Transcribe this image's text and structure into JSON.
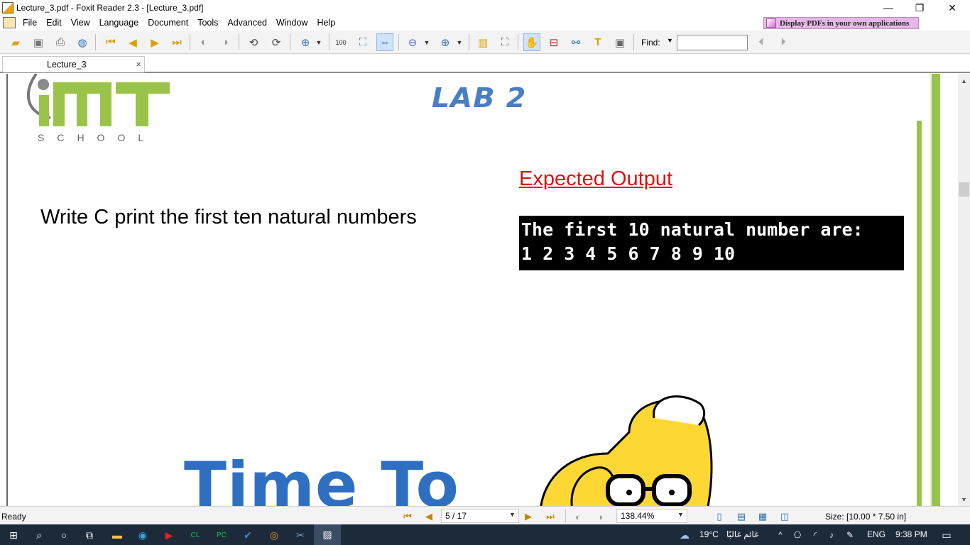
{
  "window": {
    "title": "Lecture_3.pdf - Foxit Reader 2.3 - [Lecture_3.pdf]",
    "minimize": "—",
    "restore": "❐",
    "close": "✕"
  },
  "menu": {
    "items": [
      "File",
      "Edit",
      "View",
      "Language",
      "Document",
      "Tools",
      "Advanced",
      "Window",
      "Help"
    ],
    "promo": "Display PDFs in your own applications"
  },
  "toolbar": {
    "find_label": "Find:",
    "find_value": ""
  },
  "tabs": [
    {
      "label": "Lecture_3",
      "close": "×"
    }
  ],
  "document": {
    "logo_main": "IMT",
    "logo_sub": "SCHOOL",
    "lab_title": "LAB 2",
    "expected_heading": "Expected Output",
    "question": "Write C print the first ten natural numbers",
    "console_lines": [
      "The first 10 natural number are:",
      "1 2 3 4 5 6 7 8 9 10"
    ],
    "banner": "Time To"
  },
  "status": {
    "ready": "Ready",
    "page": "5 / 17",
    "zoom": "138.44%",
    "size": "Size: [10.00 * 7.50 in]"
  },
  "taskbar": {
    "weather_temp": "19°C",
    "weather_desc": "غائم غالبًا",
    "language": "ENG",
    "time": "9:38 PM"
  },
  "colors": {
    "accent_green": "#9ac34a",
    "lab_blue": "#4a7ec4",
    "expected_red": "#e01010",
    "banner_blue": "#2f6fc2"
  }
}
